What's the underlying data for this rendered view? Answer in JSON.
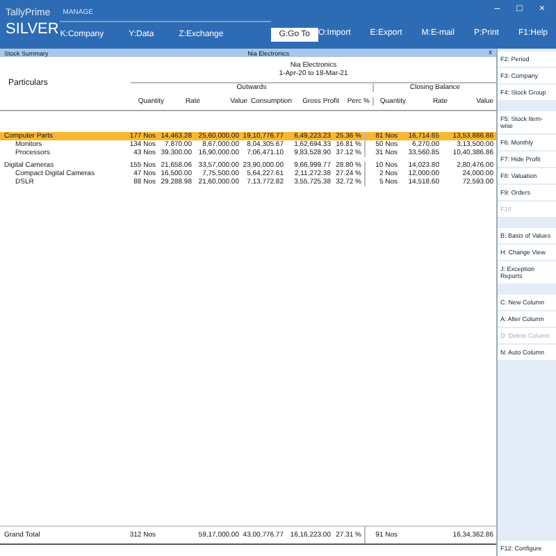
{
  "app": {
    "brand": "TallyPrime",
    "edition": "SILVER",
    "manage": "MANAGE"
  },
  "menu_left": [
    "K:Company",
    "Y:Data",
    "Z:Exchange"
  ],
  "goto": "G:Go To",
  "menu_right": [
    "O:Import",
    "E:Export",
    "M:E-mail",
    "P:Print"
  ],
  "help": "F1:Help",
  "window_controls": [
    "–",
    "□",
    "×"
  ],
  "subbar": {
    "title": "Stock Summary",
    "company": "Nia Electronics",
    "close": "x"
  },
  "report": {
    "company": "Nia Electronics",
    "period": "1-Apr-20 to 18-Mar-21",
    "particulars": "Particulars",
    "groups": [
      "Outwards",
      "Closing Balance"
    ],
    "columns": [
      "Quantity",
      "Rate",
      "Value",
      "Consumption",
      "Gross Profit",
      "Perc %",
      "Quantity",
      "Rate",
      "Value"
    ]
  },
  "rows": [
    {
      "name": "Computer Parts",
      "selected": true,
      "values": [
        "177 Nos",
        "14,463.28",
        "25,60,000.00",
        "19,10,776.77",
        "6,49,223.23",
        "25.36 %",
        "81 Nos",
        "16,714.65",
        "13,53,886.86"
      ],
      "children": [
        {
          "name": "Monitors",
          "selected": false,
          "values": [
            "134 Nos",
            "7,870.00",
            "8,67,000.00",
            "8,04,305.67",
            "1,62,694.33",
            "16.81 %",
            "50 Nos",
            "6,270.00",
            "3,13,500.00"
          ]
        },
        {
          "name": "Processors",
          "selected": false,
          "values": [
            "43 Nos",
            "39,300.00",
            "16,90,000.00",
            "7,06,471.10",
            "9,83,528.90",
            "37.12 %",
            "31 Nos",
            "33,560.85",
            "10,40,386.86"
          ]
        }
      ]
    },
    {
      "name": "Digital Cameras",
      "selected": false,
      "values": [
        "155 Nos",
        "21,658.06",
        "33,57,000.00",
        "23,90,000.00",
        "9,66,999.77",
        "28.80 %",
        "10 Nos",
        "14,023.80",
        "2,80,476.00"
      ],
      "children": [
        {
          "name": "Compact Digital Cameras",
          "selected": false,
          "values": [
            "47 Nos",
            "16,500.00",
            "7,75,500.00",
            "5,64,227.61",
            "2,11,272.38",
            "27.24 %",
            "2 Nos",
            "12,000.00",
            "24,000.00"
          ]
        },
        {
          "name": "DSLR",
          "selected": false,
          "values": [
            "88 Nos",
            "29,288.98",
            "21,60,000.00",
            "7,13,772.82",
            "3,55,725.38",
            "32.72 %",
            "5 Nos",
            "14,518.60",
            "72,593.00"
          ]
        }
      ]
    }
  ],
  "grand_total": {
    "label": "Grand Total",
    "outwards_quantity": "312 Nos",
    "outwards_value": "59,17,000.00",
    "consumption": "43,00,776.77",
    "gross_profit": "16,16,223.00",
    "perc": "27.31 %",
    "closing_quantity": "91 Nos",
    "closing_value": "16,34,362.86"
  },
  "sidebar": [
    [
      {
        "label": "F2: Period",
        "disabled": false
      },
      {
        "label": "F3: Company",
        "disabled": false
      },
      {
        "label": "F4: Stock Group",
        "disabled": false
      }
    ],
    [
      {
        "label": "F5: Stock Item-wise",
        "disabled": false
      },
      {
        "label": "F6: Monthly",
        "disabled": false
      },
      {
        "label": "F7: Hide Profit",
        "disabled": false
      },
      {
        "label": "F8: Valuation",
        "disabled": false
      },
      {
        "label": "F9: Orders",
        "disabled": false
      },
      {
        "label": "F10",
        "disabled": true
      }
    ],
    [
      {
        "label": "B: Basis of Values",
        "disabled": false
      },
      {
        "label": "H: Change View",
        "disabled": false
      },
      {
        "label": "J: Exception Reports",
        "disabled": false
      }
    ],
    [
      {
        "label": "C: New Column",
        "disabled": false
      },
      {
        "label": "A: Alter Column",
        "disabled": false
      },
      {
        "label": "D: Delete Column",
        "disabled": true
      },
      {
        "label": "N: Auto Column",
        "disabled": false
      }
    ]
  ],
  "configure": "F12: Configure"
}
